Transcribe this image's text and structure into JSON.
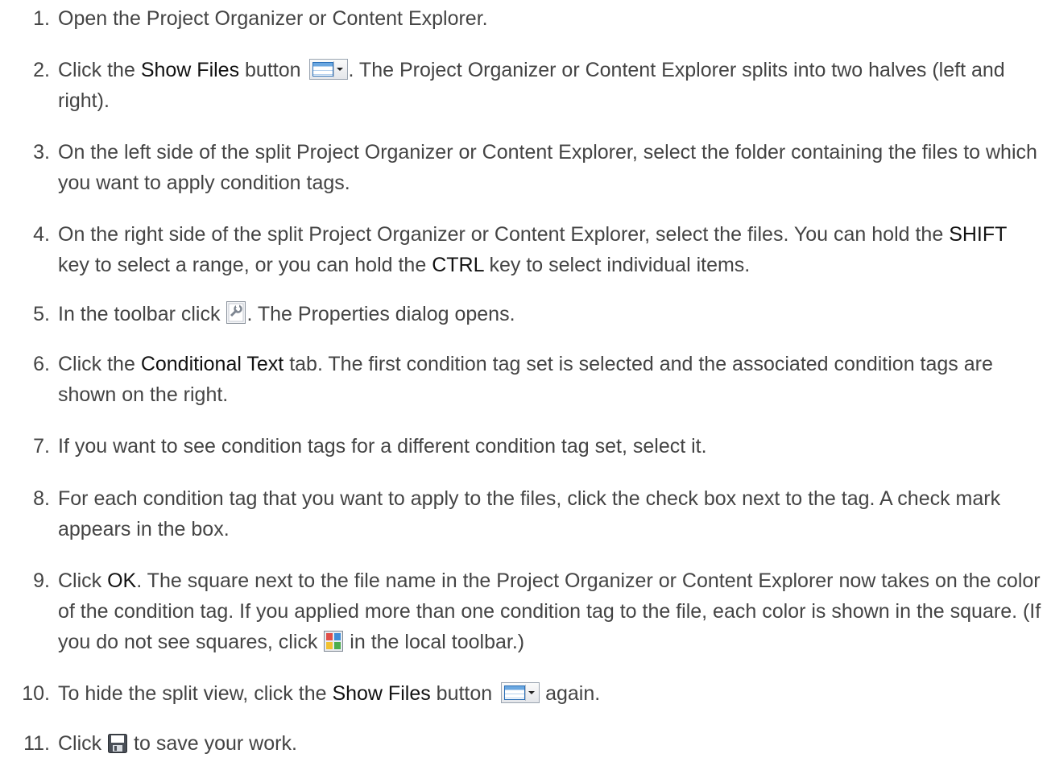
{
  "steps": [
    {
      "n": "1.",
      "parts": [
        {
          "t": "Open the Project Organizer or Content Explorer."
        }
      ]
    },
    {
      "n": "2.",
      "parts": [
        {
          "t": "Click the "
        },
        {
          "b": "Show Files"
        },
        {
          "t": " button "
        },
        {
          "icon": "show-files-button-icon"
        },
        {
          "t": ". The Project Organizer or Content Explorer splits into two halves (left and right)."
        }
      ]
    },
    {
      "n": "3.",
      "parts": [
        {
          "t": "On the left side of the split Project Organizer or Content Explorer, select the folder containing the files to which you want to apply condition tags."
        }
      ]
    },
    {
      "n": "4.",
      "parts": [
        {
          "t": "On the right side of the split Project Organizer or Content Explorer, select the files. You can hold the "
        },
        {
          "b": "SHIFT"
        },
        {
          "t": " key to select a range, or you can hold the "
        },
        {
          "b": "CTRL"
        },
        {
          "t": " key to select individual items."
        }
      ]
    },
    {
      "n": "5.",
      "parts": [
        {
          "t": "In the toolbar click "
        },
        {
          "icon": "properties-icon"
        },
        {
          "t": ". The Properties dialog opens."
        }
      ]
    },
    {
      "n": "6.",
      "parts": [
        {
          "t": "Click the "
        },
        {
          "b": "Conditional Text"
        },
        {
          "t": " tab. The first condition tag set is selected and the associated condition tags are shown on the right."
        }
      ]
    },
    {
      "n": "7.",
      "parts": [
        {
          "t": "If you want to see condition tags for a different condition tag set, select it."
        }
      ]
    },
    {
      "n": "8.",
      "parts": [
        {
          "t": "For each condition tag that you want to apply to the files, click the check box next to the tag. A check mark appears in the box."
        }
      ]
    },
    {
      "n": "9.",
      "parts": [
        {
          "t": "Click "
        },
        {
          "b": "OK"
        },
        {
          "t": ". The square next to the file name in the Project Organizer or Content Explorer now takes on the color of the condition tag. If you applied more than one condition tag to the file, each color is shown in the square. (If you do not see squares, click "
        },
        {
          "icon": "condition-colors-icon"
        },
        {
          "t": " in the local toolbar.)"
        }
      ]
    },
    {
      "n": "10.",
      "parts": [
        {
          "t": "To hide the split view, click the "
        },
        {
          "b": "Show Files"
        },
        {
          "t": " button "
        },
        {
          "icon": "show-files-button-icon"
        },
        {
          "t": " again."
        }
      ]
    },
    {
      "n": "11.",
      "parts": [
        {
          "t": "Click "
        },
        {
          "icon": "save-icon"
        },
        {
          "t": " to save your work."
        }
      ]
    }
  ]
}
